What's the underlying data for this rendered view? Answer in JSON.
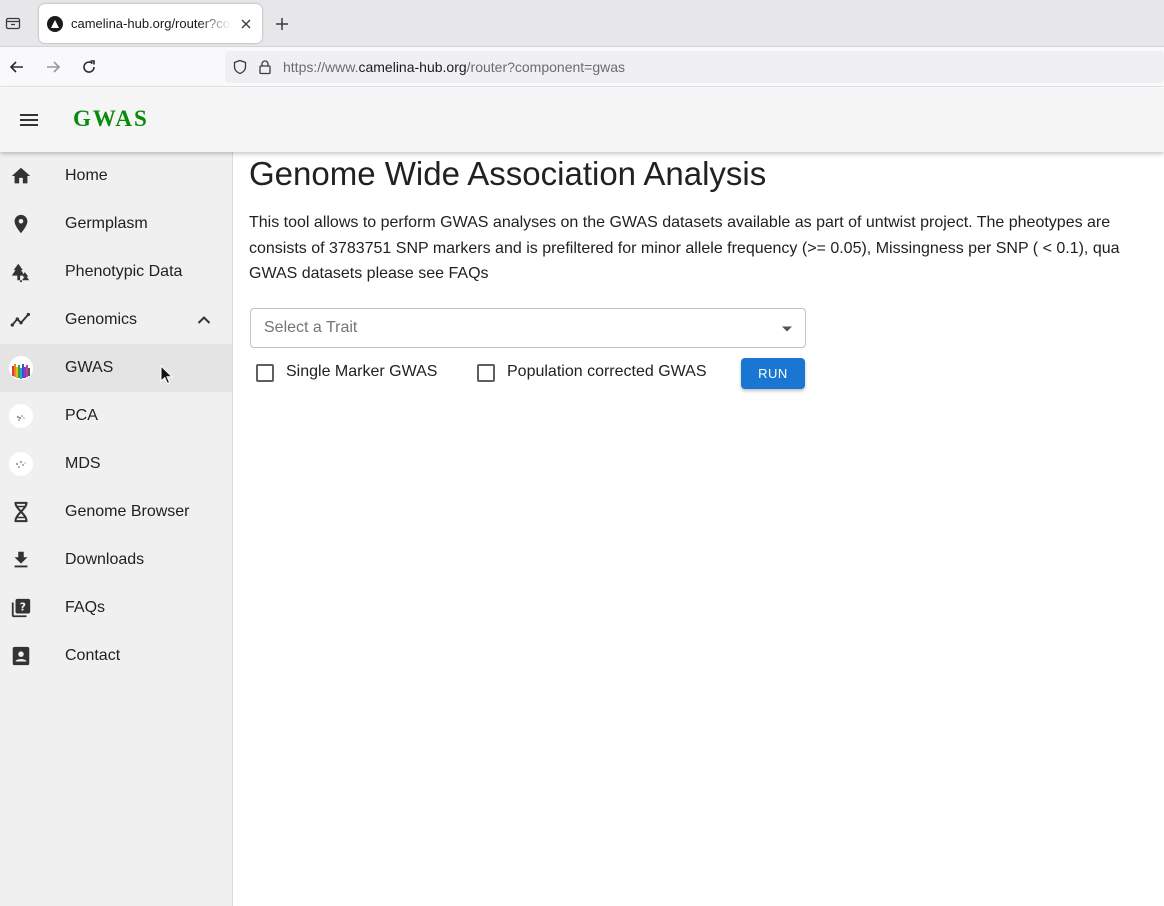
{
  "browser": {
    "tab_title": "camelina-hub.org/router?component=gwas",
    "url_prefix": "https://www.",
    "url_host": "camelina-hub.org",
    "url_path": "/router?component=gwas"
  },
  "appbar": {
    "title": "GWAS",
    "title_color": "#0a8a0a"
  },
  "sidebar": {
    "items": [
      {
        "label": "Home",
        "icon": "home-icon"
      },
      {
        "label": "Germplasm",
        "icon": "location-pin-icon"
      },
      {
        "label": "Phenotypic Data",
        "icon": "forest-icon"
      },
      {
        "label": "Genomics",
        "icon": "trend-line-icon"
      },
      {
        "label": "GWAS",
        "icon": "gwas-thumbnail-icon"
      },
      {
        "label": "PCA",
        "icon": "pca-thumbnail-icon"
      },
      {
        "label": "MDS",
        "icon": "mds-thumbnail-icon"
      },
      {
        "label": "Genome Browser",
        "icon": "dna-icon"
      },
      {
        "label": "Downloads",
        "icon": "download-icon"
      },
      {
        "label": "FAQs",
        "icon": "faq-icon"
      },
      {
        "label": "Contact",
        "icon": "contact-icon"
      }
    ],
    "active": "GWAS"
  },
  "main": {
    "title": "Genome Wide Association Analysis",
    "description_lines": [
      "This tool allows to perform GWAS analyses on the GWAS datasets available as part of untwist project. The pheotypes are",
      "consists of 3783751 SNP markers and is prefiltered for minor allele frequency (>= 0.05), Missingness per SNP ( < 0.1), qua",
      "GWAS datasets please see FAQs"
    ],
    "trait_select_placeholder": "Select a Trait",
    "checkbox_single": "Single Marker GWAS",
    "checkbox_population": "Population corrected GWAS",
    "run_label": "RUN",
    "run_color": "#1976d2"
  }
}
